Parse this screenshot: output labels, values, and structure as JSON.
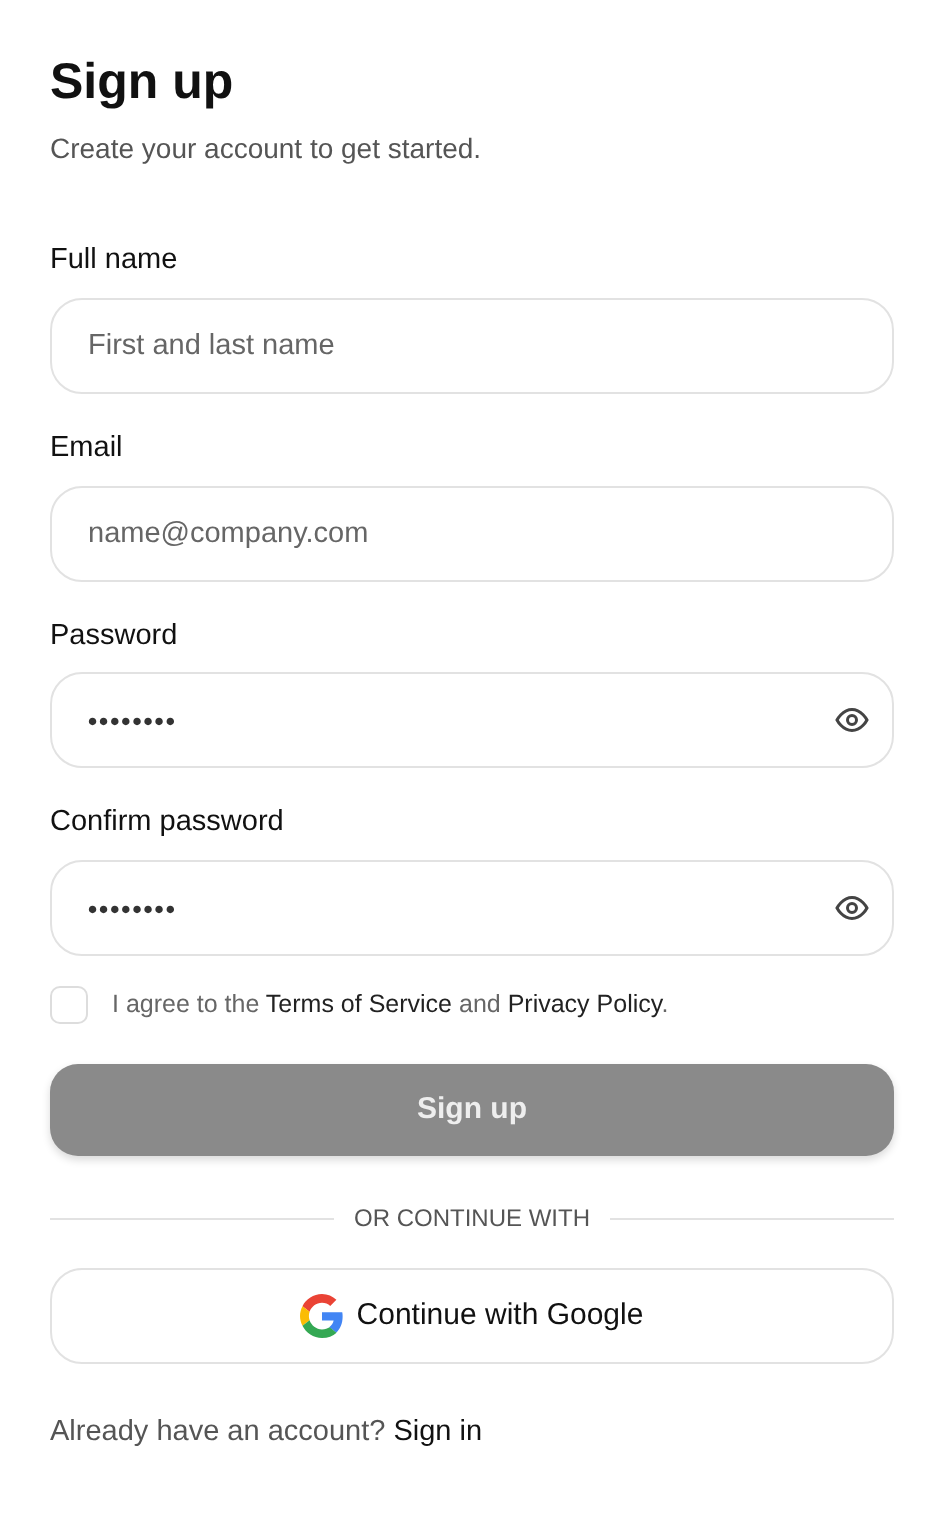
{
  "title": "Sign up",
  "subtitle": "Create your account to get started.",
  "fields": [
    {
      "label": "Full name",
      "kind": "text",
      "placeholder": "First and last name"
    },
    {
      "label": "Email",
      "kind": "text",
      "placeholder": "name@company.com"
    },
    {
      "label": "Password",
      "kind": "password",
      "value": "••••••••"
    },
    {
      "label": "Confirm password",
      "kind": "password",
      "value": "••••••••"
    }
  ],
  "agreement": {
    "checked": false,
    "parts": [
      {
        "kind": "text",
        "text": "I agree to the "
      },
      {
        "kind": "link",
        "text": "Terms of Service"
      },
      {
        "kind": "text",
        "text": " and "
      },
      {
        "kind": "link",
        "text": "Privacy Policy"
      },
      {
        "kind": "text",
        "text": "."
      }
    ]
  },
  "submit": {
    "label": "Sign up",
    "disabled": true
  },
  "divider": "OR CONTINUE WITH",
  "google_button": "Continue with Google",
  "footer": {
    "text": "Already have an account?",
    "link": "Sign in"
  }
}
